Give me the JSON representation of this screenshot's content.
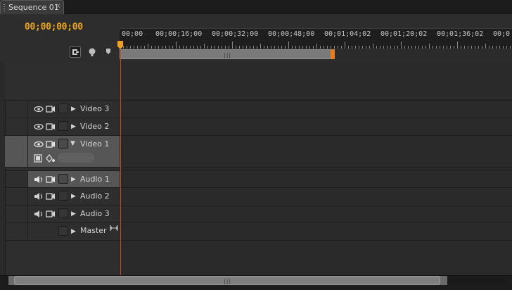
{
  "tab": {
    "title": "Sequence 01",
    "close_glyph": "x"
  },
  "timecode": "00;00;00;00",
  "ruler": {
    "labels": [
      "00;00",
      "00;00;16;00",
      "00;00;32;00",
      "00;00;48;00",
      "00;01;04;02",
      "00;01;20;02",
      "00;01;36;02",
      "00;0"
    ]
  },
  "tools": {
    "snap": "snap-icon",
    "marker": "add-marker-icon",
    "keyframe": "keyframe-icon"
  },
  "tracks": {
    "video": [
      {
        "name": "Video 3",
        "expanded": false
      },
      {
        "name": "Video 2",
        "expanded": false
      },
      {
        "name": "Video 1",
        "expanded": true,
        "selected": true
      }
    ],
    "audio": [
      {
        "name": "Audio 1",
        "expanded": false,
        "selected": true
      },
      {
        "name": "Audio 2",
        "expanded": false
      },
      {
        "name": "Audio 3",
        "expanded": false
      }
    ],
    "master": {
      "name": "Master"
    }
  },
  "colors": {
    "timecode": "#e8a41a",
    "playhead": "#d2431d",
    "workarea_end": "#e87c1a"
  }
}
